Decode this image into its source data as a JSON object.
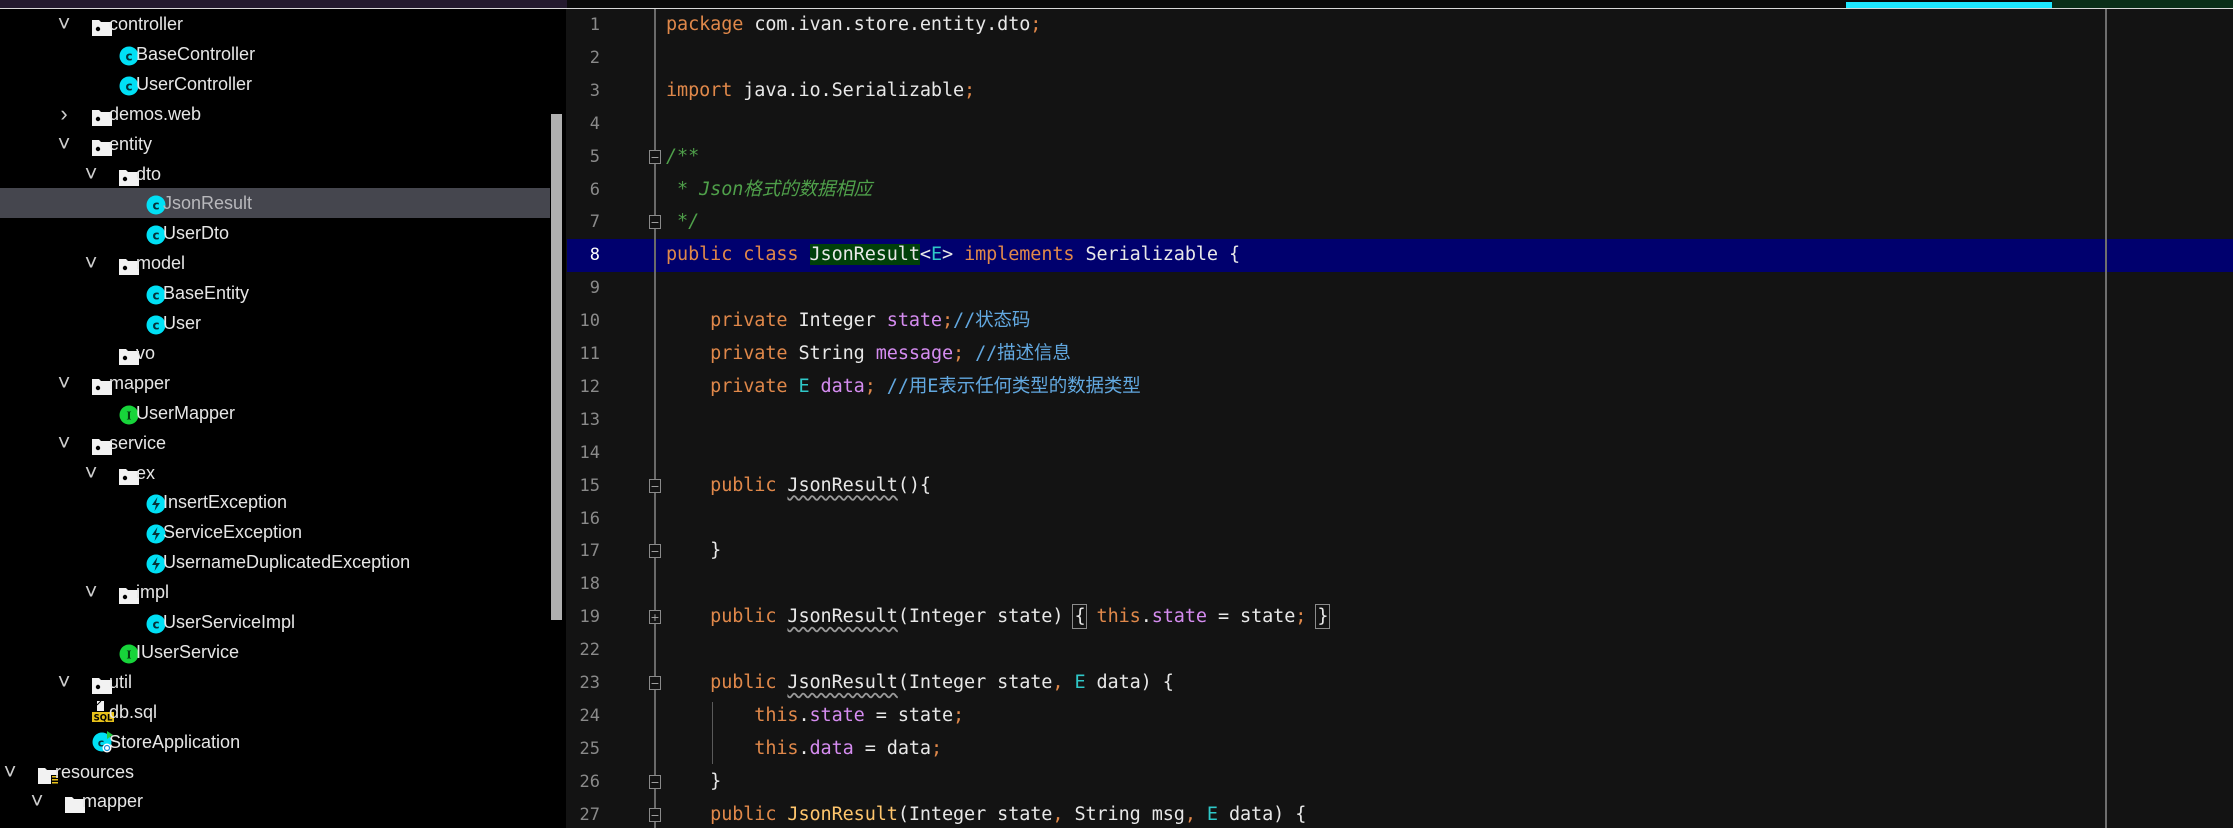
{
  "colors": {
    "accent": "#1ee8ff",
    "selection": "#45464e",
    "current_line": "#00006e",
    "keyword": "#e0884a",
    "field": "#d58cf0",
    "comment": "#4fa04a"
  },
  "project_tree": {
    "selected": "JsonResult",
    "items": [
      {
        "label": "controller",
        "depth": 2,
        "icon": "package-folder-icon",
        "expanded": true
      },
      {
        "label": "BaseController",
        "depth": 3,
        "icon": "class-icon"
      },
      {
        "label": "UserController",
        "depth": 3,
        "icon": "class-icon"
      },
      {
        "label": "demos.web",
        "depth": 2,
        "icon": "package-folder-icon",
        "expanded": false
      },
      {
        "label": "entity",
        "depth": 2,
        "icon": "package-folder-icon",
        "expanded": true
      },
      {
        "label": "dto",
        "depth": 3,
        "icon": "package-folder-icon",
        "expanded": true
      },
      {
        "label": "JsonResult",
        "depth": 4,
        "icon": "class-icon"
      },
      {
        "label": "UserDto",
        "depth": 4,
        "icon": "class-icon"
      },
      {
        "label": "model",
        "depth": 3,
        "icon": "package-folder-icon",
        "expanded": true
      },
      {
        "label": "BaseEntity",
        "depth": 4,
        "icon": "class-icon"
      },
      {
        "label": "User",
        "depth": 4,
        "icon": "class-icon"
      },
      {
        "label": "vo",
        "depth": 3,
        "icon": "package-folder-icon"
      },
      {
        "label": "mapper",
        "depth": 2,
        "icon": "package-folder-icon",
        "expanded": true
      },
      {
        "label": "UserMapper",
        "depth": 3,
        "icon": "interface-icon"
      },
      {
        "label": "service",
        "depth": 2,
        "icon": "package-folder-icon",
        "expanded": true
      },
      {
        "label": "ex",
        "depth": 3,
        "icon": "package-folder-icon",
        "expanded": true
      },
      {
        "label": "InsertException",
        "depth": 4,
        "icon": "exception-icon"
      },
      {
        "label": "ServiceException",
        "depth": 4,
        "icon": "exception-icon"
      },
      {
        "label": "UsernameDuplicatedException",
        "depth": 4,
        "icon": "exception-icon"
      },
      {
        "label": "impl",
        "depth": 3,
        "icon": "package-folder-icon",
        "expanded": true
      },
      {
        "label": "UserServiceImpl",
        "depth": 4,
        "icon": "class-icon"
      },
      {
        "label": "IUserService",
        "depth": 3,
        "icon": "interface-icon"
      },
      {
        "label": "util",
        "depth": 2,
        "icon": "package-folder-icon",
        "expanded": true
      },
      {
        "label": "db.sql",
        "depth": 2,
        "icon": "sql-file-icon"
      },
      {
        "label": "StoreApplication",
        "depth": 2,
        "icon": "spring-app-icon"
      },
      {
        "label": "resources",
        "depth": 0,
        "icon": "resources-folder-icon",
        "expanded": true
      },
      {
        "label": "mapper",
        "depth": 1,
        "icon": "folder-icon",
        "expanded": true
      }
    ]
  },
  "editor": {
    "current_line": "8",
    "lines": [
      {
        "n": "1",
        "t": [
          [
            "package",
            "kw"
          ],
          [
            " com.ivan.store.entity.dto",
            "pl"
          ],
          [
            ";",
            "kw"
          ]
        ]
      },
      {
        "n": "2",
        "t": []
      },
      {
        "n": "3",
        "t": [
          [
            "import",
            "kw"
          ],
          [
            " java.io.Serializable",
            "pl"
          ],
          [
            ";",
            "kw"
          ]
        ]
      },
      {
        "n": "4",
        "t": []
      },
      {
        "n": "5",
        "fold": "open",
        "t": [
          [
            "/**",
            "doc"
          ]
        ]
      },
      {
        "n": "6",
        "t": [
          [
            " * Json格式的数据相应",
            "doc"
          ]
        ]
      },
      {
        "n": "7",
        "fold": "close",
        "t": [
          [
            " */",
            "doc"
          ]
        ]
      },
      {
        "n": "8",
        "t": [
          [
            "public class ",
            "kw"
          ],
          [
            "JsonResult",
            "cls"
          ],
          [
            "<",
            "pl"
          ],
          [
            "E",
            "tp"
          ],
          [
            "> ",
            "pl"
          ],
          [
            "implements ",
            "kw"
          ],
          [
            "Serializable {",
            "pl"
          ]
        ]
      },
      {
        "n": "9",
        "t": []
      },
      {
        "n": "10",
        "t": [
          [
            "    private ",
            "kw"
          ],
          [
            "Integer ",
            "pl"
          ],
          [
            "state",
            "fld"
          ],
          [
            ";",
            "kw"
          ],
          [
            "//状态码",
            "cmt"
          ]
        ]
      },
      {
        "n": "11",
        "t": [
          [
            "    private ",
            "kw"
          ],
          [
            "String ",
            "pl"
          ],
          [
            "message",
            "fld"
          ],
          [
            "; ",
            "kw"
          ],
          [
            "//描述信息",
            "cmt"
          ]
        ]
      },
      {
        "n": "12",
        "t": [
          [
            "    private ",
            "kw"
          ],
          [
            "E ",
            "tp"
          ],
          [
            "data",
            "fld"
          ],
          [
            "; ",
            "kw"
          ],
          [
            "//用E表示任何类型的数据类型",
            "cmt"
          ]
        ]
      },
      {
        "n": "13",
        "t": []
      },
      {
        "n": "14",
        "t": []
      },
      {
        "n": "15",
        "fold": "open",
        "t": [
          [
            "    public ",
            "kw"
          ],
          [
            "JsonResult",
            "ctor"
          ],
          [
            "(){",
            "pl"
          ]
        ]
      },
      {
        "n": "16",
        "t": []
      },
      {
        "n": "17",
        "fold": "close",
        "t": [
          [
            "    }",
            "pl"
          ]
        ]
      },
      {
        "n": "18",
        "t": []
      },
      {
        "n": "19",
        "fold": "plus",
        "t": [
          [
            "    public ",
            "kw"
          ],
          [
            "JsonResult",
            "ctor"
          ],
          [
            "(Integer state)",
            "pl"
          ],
          [
            " ",
            "pl"
          ],
          [
            "{",
            "box"
          ],
          [
            " ",
            "pl"
          ],
          [
            "this",
            "kw"
          ],
          [
            ".",
            "pl"
          ],
          [
            "state",
            "fld"
          ],
          [
            " = state",
            "pl"
          ],
          [
            ";",
            "kw"
          ],
          [
            " ",
            "pl"
          ],
          [
            "}",
            "box"
          ]
        ]
      },
      {
        "n": "22",
        "t": []
      },
      {
        "n": "23",
        "fold": "open",
        "t": [
          [
            "    public ",
            "kw"
          ],
          [
            "JsonResult",
            "ctor"
          ],
          [
            "(Integer state",
            "pl"
          ],
          [
            ", ",
            "kw"
          ],
          [
            "E ",
            "tp"
          ],
          [
            "data) {",
            "pl"
          ]
        ]
      },
      {
        "n": "24",
        "t": [
          [
            "        this",
            "kw"
          ],
          [
            ".",
            "pl"
          ],
          [
            "state",
            "fld"
          ],
          [
            " = state",
            "pl"
          ],
          [
            ";",
            "kw"
          ]
        ]
      },
      {
        "n": "25",
        "t": [
          [
            "        this",
            "kw"
          ],
          [
            ".",
            "pl"
          ],
          [
            "data",
            "fld"
          ],
          [
            " = data",
            "pl"
          ],
          [
            ";",
            "kw"
          ]
        ]
      },
      {
        "n": "26",
        "fold": "close",
        "t": [
          [
            "    }",
            "pl"
          ]
        ]
      },
      {
        "n": "27",
        "fold": "open",
        "t": [
          [
            "    public ",
            "kw"
          ],
          [
            "JsonResult",
            "ctorY"
          ],
          [
            "(Integer state",
            "pl"
          ],
          [
            ", ",
            "kw"
          ],
          [
            "String msg",
            "pl"
          ],
          [
            ", ",
            "kw"
          ],
          [
            "E ",
            "tp"
          ],
          [
            "data) {",
            "pl"
          ]
        ]
      }
    ]
  }
}
